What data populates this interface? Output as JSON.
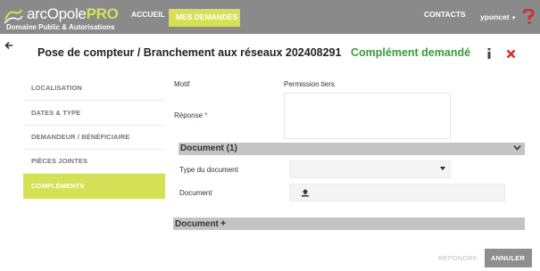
{
  "header": {
    "logo_prefix": "arcOpole",
    "logo_suffix": "PRO",
    "logo_tagline": "Domaine Public & Autorisations",
    "nav": [
      {
        "label": "ACCUEIL"
      },
      {
        "label": "MES DEMANDES"
      },
      {
        "label": "CONTACTS"
      }
    ],
    "user": "yponcet",
    "colors": {
      "bar": "#8a8a8a",
      "accent": "#d4e157"
    }
  },
  "page": {
    "title": "Pose de compteur / Branchement aux réseaux 202408291",
    "status": "Complément demandé",
    "status_color": "#3a9a3a"
  },
  "sidebar": {
    "items": [
      {
        "label": "LOCALISATION"
      },
      {
        "label": "DATES & TYPE"
      },
      {
        "label": "DEMANDEUR / BÉNÉFICIAIRE"
      },
      {
        "label": "PIÈCES JOINTES"
      },
      {
        "label": "COMPLÉMENTS",
        "active": true
      }
    ]
  },
  "form": {
    "motif_label": "Motif",
    "motif_value": "Permission tiers",
    "reponse_label": "Réponse",
    "reponse_required": "*",
    "reponse_value": "",
    "section_title": "Document (1)",
    "type_label": "Type du document",
    "type_value": "",
    "document_label": "Document",
    "add_section_title": "Document"
  },
  "actions": {
    "repondre": "RÉPONDRE",
    "annuler": "ANNULER"
  }
}
